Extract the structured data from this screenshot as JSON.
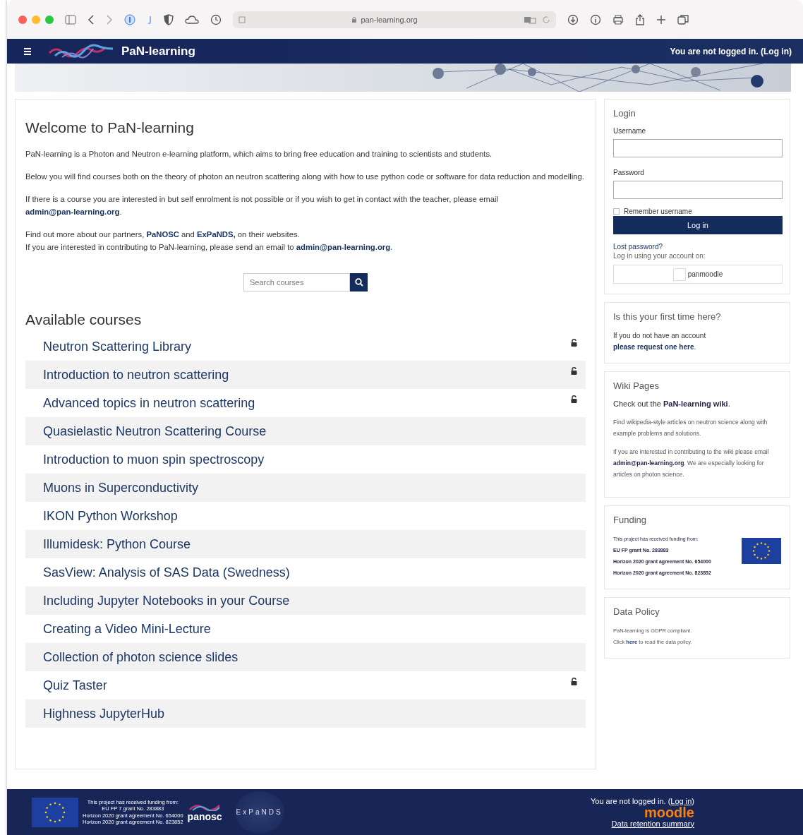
{
  "browser": {
    "url": "pan-learning.org"
  },
  "navbar": {
    "brand": "PaN-learning",
    "login_text": "You are not logged in. (Log in)"
  },
  "main": {
    "title": "Welcome to PaN-learning",
    "paragraphs": [
      [
        {
          "text": "PaN-learning is a Photon and Neutron e-learning platform, which aims to bring free education and training to scientists and students.",
          "link": false
        }
      ],
      [
        {
          "text": "Below you will find courses both on the theory of photon an neutron scattering along with how to use python code or software for data reduction and modelling.",
          "link": false
        }
      ],
      [
        {
          "text": "If there is a course you are interested in but self enrolment is not possible or if you wish to get in contact with the teacher, please email ",
          "link": false
        },
        {
          "text": "admin@pan-learning.org",
          "link": true
        },
        {
          "text": ".",
          "link": false
        }
      ],
      [
        {
          "text": "Find out more about our partners, ",
          "link": false
        },
        {
          "text": "PaNOSC",
          "link": true
        },
        {
          "text": " and ",
          "link": false
        },
        {
          "text": "ExPaNDS,",
          "link": true
        },
        {
          "text": " on their websites.",
          "link": false
        }
      ],
      [
        {
          "text": "If you are interested in contributing to PaN-learning, please send an email to ",
          "link": false
        },
        {
          "text": "admin@pan-learning.org",
          "link": true
        },
        {
          "text": ".",
          "link": false
        }
      ]
    ],
    "search": {
      "placeholder": "Search courses"
    },
    "courses_title": "Available courses",
    "courses": [
      {
        "name": "Neutron Scattering Library",
        "guest": true
      },
      {
        "name": "Introduction to neutron scattering",
        "guest": true
      },
      {
        "name": "Advanced topics in neutron scattering",
        "guest": true
      },
      {
        "name": "Quasielastic Neutron Scattering Course",
        "guest": false
      },
      {
        "name": "Introduction to muon spin spectroscopy",
        "guest": false
      },
      {
        "name": "Muons in Superconductivity",
        "guest": false
      },
      {
        "name": "IKON Python Workshop",
        "guest": false
      },
      {
        "name": "Illumidesk: Python Course",
        "guest": false
      },
      {
        "name": "SasView: Analysis of SAS Data (Swedness)",
        "guest": false
      },
      {
        "name": "Including Jupyter Notebooks in your Course",
        "guest": false
      },
      {
        "name": "Creating a Video Mini-Lecture",
        "guest": false
      },
      {
        "name": "Collection of photon science slides",
        "guest": false
      },
      {
        "name": "Quiz Taster",
        "guest": true
      },
      {
        "name": "Highness JupyterHub",
        "guest": false
      }
    ]
  },
  "login": {
    "title": "Login",
    "username_label": "Username",
    "password_label": "Password",
    "remember": {
      "label": "Remember username",
      "checked": false
    },
    "button": "Log in",
    "lost_password": "Lost password?",
    "oauth_text": "Log in using your account on:",
    "oauth_button": "panmoodle"
  },
  "first_time": {
    "title": "Is this your first time here?",
    "text": "If you do not have an account ",
    "link": "please request one here",
    "end": "."
  },
  "wiki": {
    "title": "Wiki Pages",
    "lead": "Check out the ",
    "lead_link": "PaN-learning wiki",
    "lead_end": ".",
    "text1": "Find wikipedia-style articles on neutron science along with example problems and solutions.",
    "text2": "If you are interested in contributing to the wiki please email ",
    "text2_link": "admin@pan-learning.org",
    "text2_end": ". We are especially looking for articles on photon science."
  },
  "funding": {
    "title": "Funding",
    "lines": [
      "This project has received funding from:",
      "**EU FP grant No. 283883**",
      "**Horizon 2020 grant agreement No. 654000**",
      "**Horizon 2020 grant agreement No. 823852**"
    ]
  },
  "data_policy": {
    "title": "Data Policy",
    "line1": "PaN-learning is GDPR compliant.",
    "line2_start": "Click ",
    "line2_link": "here",
    "line2_end": " to read the data policy."
  },
  "footer": {
    "funding_lines": [
      "This project has received funding from:",
      "EU FP 7 grant No. 283883",
      "Horizon 2020 grant agreement No. 654000",
      "Horizon 2020 grant agreement No. 823852"
    ],
    "panosc": "panosc",
    "expands": "ExPaNDS",
    "login_text": "You are not logged in. (",
    "login_link": "Log in",
    "login_end": ")",
    "moodle": "moodle",
    "retention": "Data retention summary"
  }
}
